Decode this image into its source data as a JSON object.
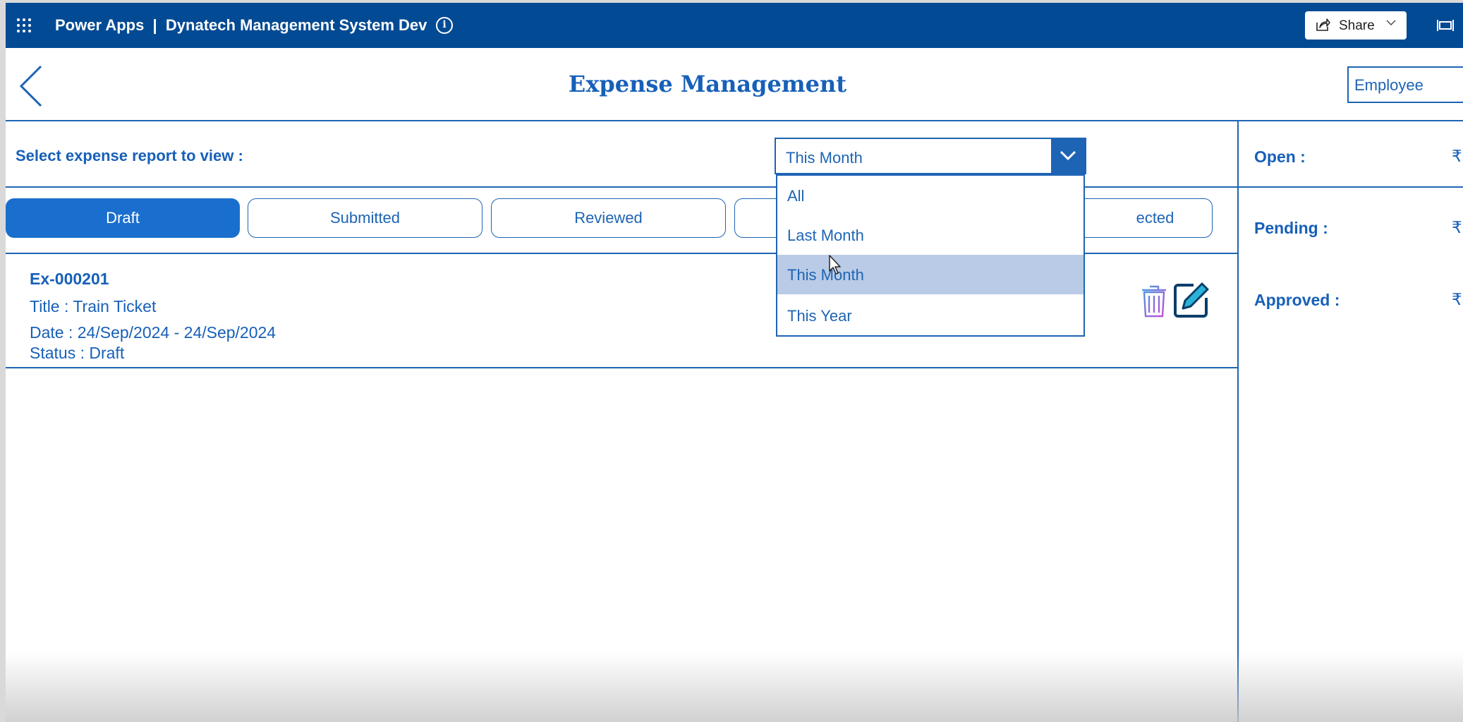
{
  "topbar": {
    "app_title": "Power Apps  |  Dynatech Management System Dev",
    "share_label": "Share"
  },
  "header": {
    "title": "Expense Management",
    "role": "Employee"
  },
  "filter": {
    "label": "Select expense report to view :",
    "selected": "This Month",
    "options": [
      "All",
      "Last Month",
      "This Month",
      "This Year"
    ]
  },
  "tabs": [
    {
      "label": "Draft"
    },
    {
      "label": "Submitted"
    },
    {
      "label": "Reviewed"
    },
    {
      "label": ""
    },
    {
      "label": "ected"
    }
  ],
  "report": {
    "id": "Ex-000201",
    "title": "Title : Train Ticket",
    "date": "Date : 24/Sep/2024 - 24/Sep/2024",
    "status": "Status : Draft"
  },
  "summary": {
    "open_label": "Open :",
    "open_value": "₹",
    "pending_label": "Pending :",
    "pending_value": "₹",
    "approved_label": "Approved :",
    "approved_value": "₹"
  },
  "colors": {
    "topbar": "#034a94",
    "accent": "#1e64b4",
    "active_tab": "#1a6fce",
    "selected_option": "#b9cbe6"
  }
}
